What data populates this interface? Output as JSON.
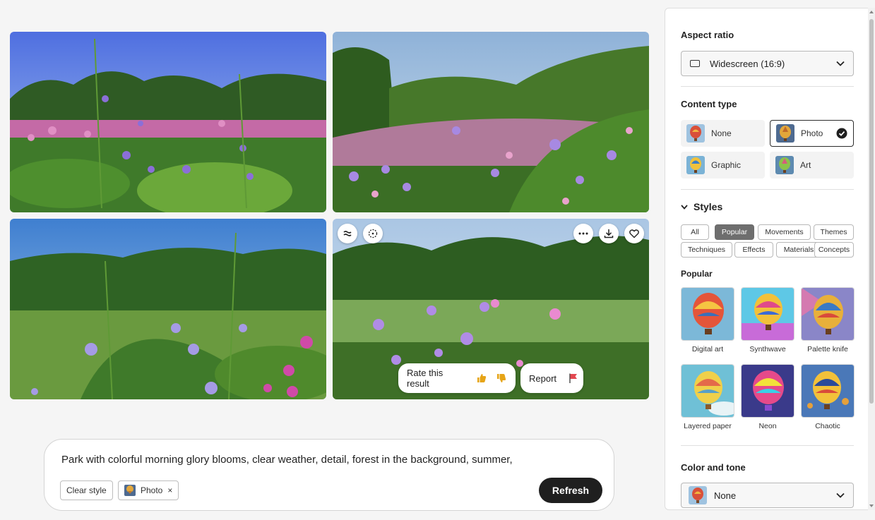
{
  "prompt": {
    "text": "Park with colorful morning glory blooms, clear weather, detail, forest in the background, summer,",
    "clear_style_label": "Clear style",
    "style_chip_label": "Photo",
    "refresh_label": "Refresh"
  },
  "image_grid": {
    "hover_actions": {
      "rate_label": "Rate this result",
      "report_label": "Report"
    },
    "icons": [
      "similar-icon",
      "reference-icon",
      "more-icon",
      "download-icon",
      "favorite-icon",
      "thumbs-up-icon",
      "thumbs-down-icon",
      "flag-icon"
    ]
  },
  "panel": {
    "aspect_ratio": {
      "title": "Aspect ratio",
      "value": "Widescreen (16:9)"
    },
    "content_type": {
      "title": "Content type",
      "options": [
        {
          "label": "None",
          "selected": false
        },
        {
          "label": "Photo",
          "selected": true
        },
        {
          "label": "Graphic",
          "selected": false
        },
        {
          "label": "Art",
          "selected": false
        }
      ]
    },
    "styles": {
      "title": "Styles",
      "tabs": [
        "All",
        "Popular",
        "Movements",
        "Themes",
        "Techniques",
        "Effects",
        "Materials",
        "Concepts"
      ],
      "active_tab": "Popular",
      "section_label": "Popular",
      "items": [
        "Digital art",
        "Synthwave",
        "Palette knife",
        "Layered paper",
        "Neon",
        "Chaotic"
      ]
    },
    "color_tone": {
      "title": "Color and tone",
      "value": "None"
    }
  },
  "colors": {
    "accent_dark": "#1f1f1f",
    "report_flag": "#e34850",
    "thumbs": "#e6a417"
  }
}
